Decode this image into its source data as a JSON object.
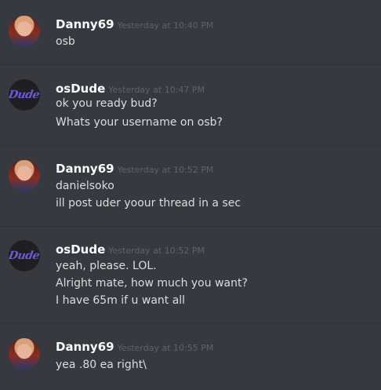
{
  "messages": [
    {
      "author": "Danny69",
      "timestamp": "Yesterday at 10:40 PM",
      "avatar_icon": "user-avatar-photo",
      "lines": [
        "osb"
      ]
    },
    {
      "author": "osDude",
      "timestamp": "Yesterday at 10:47 PM",
      "avatar_icon": "dude-logo-avatar",
      "avatar_text": "Dude",
      "lines": [
        "ok you ready bud?",
        "Whats your username on osb?"
      ]
    },
    {
      "author": "Danny69",
      "timestamp": "Yesterday at 10:52 PM",
      "avatar_icon": "user-avatar-photo",
      "lines": [
        "danielsoko",
        "ill post uder yoour thread in a sec"
      ]
    },
    {
      "author": "osDude",
      "timestamp": "Yesterday at 10:52 PM",
      "avatar_icon": "dude-logo-avatar",
      "avatar_text": "Dude",
      "lines": [
        "yeah, please. LOL.",
        "Alright mate, how much you want?",
        "I have 65m if u want all"
      ]
    },
    {
      "author": "Danny69",
      "timestamp": "Yesterday at 10:55 PM",
      "avatar_icon": "user-avatar-photo",
      "lines": [
        "yea .80 ea right\\"
      ]
    }
  ],
  "colors": {
    "background": "#36393f",
    "username": "#ffffff",
    "timestamp": "#5f6368",
    "message_text": "#dcddde",
    "divider": "#2f3136",
    "dude_logo": "#6c5bd6"
  }
}
